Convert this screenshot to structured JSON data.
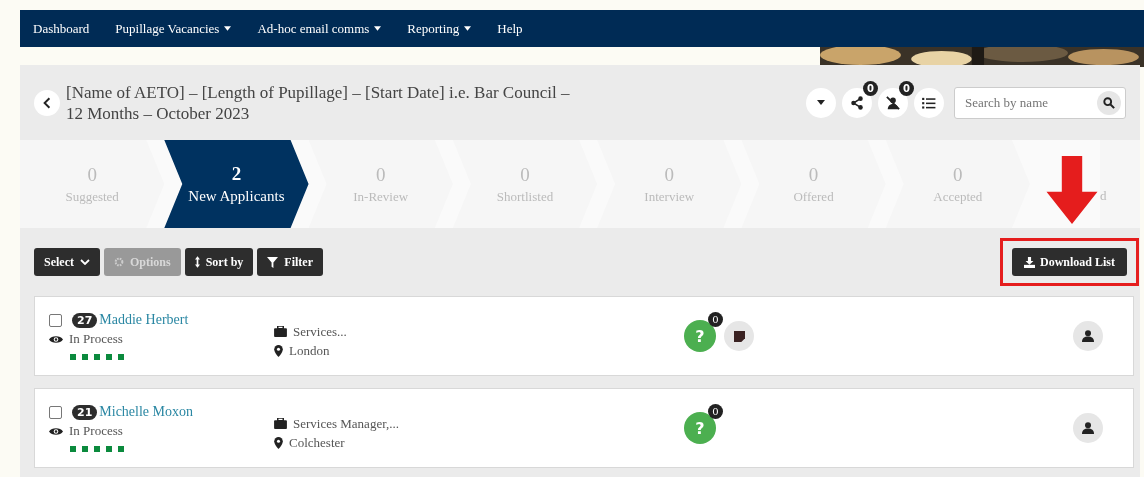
{
  "nav": [
    {
      "label": "Dashboard",
      "dropdown": false
    },
    {
      "label": "Pupillage Vacancies",
      "dropdown": true
    },
    {
      "label": "Ad-hoc email comms",
      "dropdown": true
    },
    {
      "label": "Reporting",
      "dropdown": true
    },
    {
      "label": "Help",
      "dropdown": false
    }
  ],
  "header": {
    "title": "[Name of AETO] – [Length of Pupillage] – [Start Date] i.e. Bar Council – 12 Months – October 2023",
    "share_count": "0",
    "unassigned_count": "0",
    "search": {
      "placeholder": "Search by name"
    }
  },
  "stages": [
    {
      "count": "0",
      "label": "Suggested",
      "selected": false
    },
    {
      "count": "2",
      "label": "New Applicants",
      "selected": true
    },
    {
      "count": "0",
      "label": "In-Review",
      "selected": false
    },
    {
      "count": "0",
      "label": "Shortlisted",
      "selected": false
    },
    {
      "count": "0",
      "label": "Interview",
      "selected": false
    },
    {
      "count": "0",
      "label": "Offered",
      "selected": false
    },
    {
      "count": "0",
      "label": "Accepted",
      "selected": false
    },
    {
      "label": "d",
      "selected": false
    }
  ],
  "toolbar": [
    {
      "label": "Select",
      "kind": "select",
      "disabled": false
    },
    {
      "label": "Options",
      "kind": "options",
      "disabled": true
    },
    {
      "label": "Sort by",
      "kind": "sort",
      "disabled": false
    },
    {
      "label": "Filter",
      "kind": "filter",
      "disabled": false
    }
  ],
  "download_button": "Download List",
  "applicants": [
    {
      "score": "27",
      "name": "Maddie Herbert",
      "checked": false,
      "status": "In Process",
      "stars": 5,
      "role": "Services...",
      "location": "London",
      "question_mark": "?",
      "question_count": "0",
      "has_note": true
    },
    {
      "score": "21",
      "name": "Michelle Moxon",
      "checked": false,
      "status": "In Process",
      "stars": 5,
      "role": "Services Manager,...",
      "location": "Colchester",
      "question_mark": "?",
      "question_count": "0",
      "has_note": false
    }
  ]
}
